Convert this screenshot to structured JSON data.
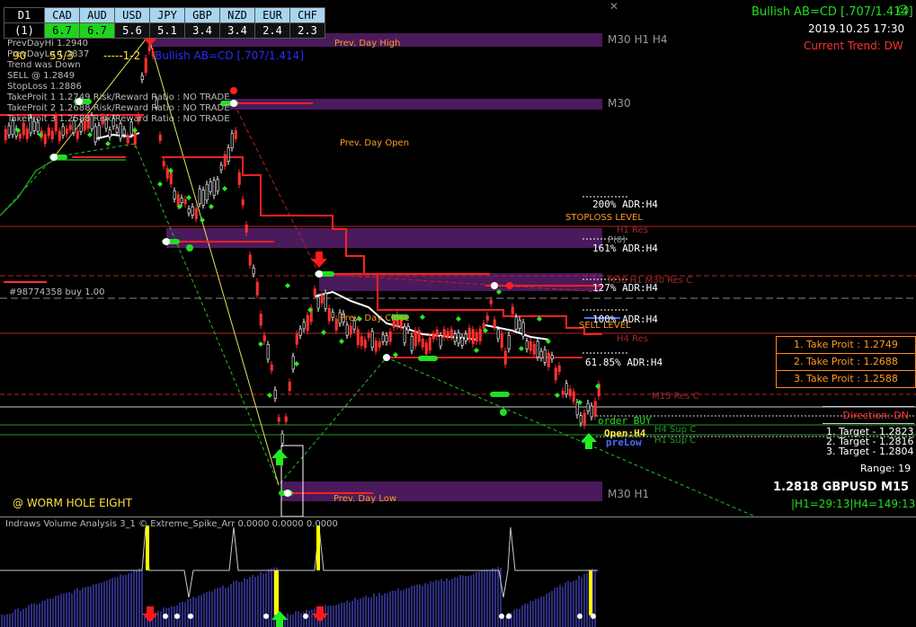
{
  "currency_table": {
    "timeframe": "D1",
    "row_label": "(1)",
    "headers": [
      "CAD",
      "AUD",
      "USD",
      "JPY",
      "GBP",
      "NZD",
      "EUR",
      "CHF"
    ],
    "values": [
      "6.7",
      "6.7",
      "5.6",
      "5.1",
      "3.4",
      "3.4",
      "2.4",
      "2.3"
    ],
    "highlight_color": "#1fd31f"
  },
  "info_panel": {
    "lines": [
      "PrevDayHi 1.2940",
      "PrevDayLo 1.2837",
      "Trend was Down",
      "SELL @ 1.2849",
      "StopLoss 1.2886",
      "TakeProit 1 1.2749 Risk/Reward Ratio : NO TRADE",
      "TakeProit 2 1.2688 Risk/Reward Ratio : NO TRADE",
      "TakeProit 3 1.2588 Risk/Reward Ratio : NO TRADE"
    ],
    "fib_90": "90",
    "fib_553": "55/3",
    "pattern_12": "-----1-2"
  },
  "header": {
    "pattern_title": "Bullish AB=CD [.707/1.414]",
    "pattern_left": "Bullish AB=CD [.707/1.414]",
    "datetime": "2019.10.25 17:30",
    "trend": "Current Trend: DW"
  },
  "zone_labels": {
    "m30_h1_h4": "M30 H1 H4",
    "m30": "M30",
    "m30_h1": "M30 H1",
    "prev_day_high": "Prev. Day High",
    "prev_day_open": "Prev. Day Open",
    "prev_day_close": "Prev. Day Close",
    "prev_day_low": "Prev. Day Low",
    "stoploss": "STOPLOSS LEVEL",
    "sell_level": "SELL LEVEL"
  },
  "adr_labels": [
    "200% ADR:H4",
    "161% ADR:H4",
    "127% ADR:H4",
    "100% ADR:H4",
    "61.85% ADR:H4"
  ],
  "res_sup_labels": {
    "h1_res": "H1 Res",
    "m30_res": "M30 H1 M30 Res C",
    "h4_res": "H4 Res",
    "m15_res": "M15 Res C",
    "h4_sup": "H4 Sup C",
    "h1_sup": "H1 Sup C",
    "m30_label": "M30",
    "order_label": "#98774358 buy 1.00"
  },
  "orders": {
    "order_buy": "order BUY",
    "open_h4": "Open:H4",
    "prelow": "preLow",
    "pivot": "P(0)"
  },
  "take_profit_box": [
    "1. Take Proit : 1.2749",
    "2. Take Proit : 1.2688",
    "3. Take Proit : 1.2588"
  ],
  "direction": "Direction: DN",
  "targets": [
    "1. Target - 1.2823",
    "2. Target - 1.2816",
    "3. Target - 1.2804"
  ],
  "range": "Range: 19",
  "price_symbol": "1.2818 GBPUSD M15",
  "timer": "|H1=29:13|H4=149:13",
  "brand": "@ WORM HOLE EIGHT",
  "subwindow_title": "Indraws Volume Analysis 3_1 © Extreme_Spike_Arr 0.0000 0.0000 0.0000",
  "colors": {
    "bull": "#ffffff",
    "bear": "#ff3030",
    "zone": "#4a1a5c",
    "accent_green": "#00ff00",
    "orange": "#ff9b24",
    "histogram": "#5a5aff"
  }
}
